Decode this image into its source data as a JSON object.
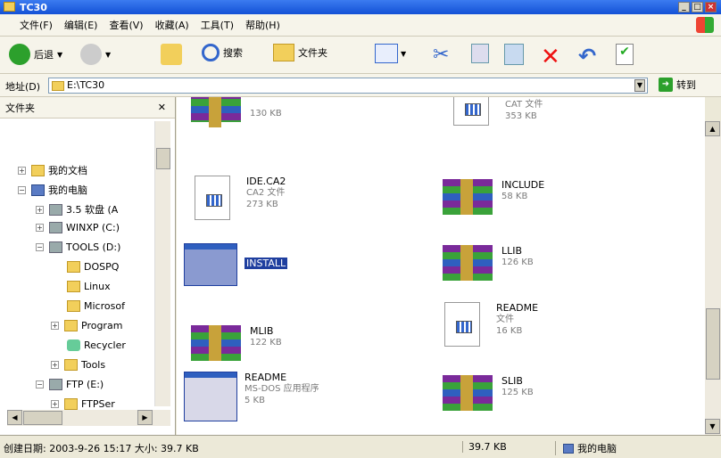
{
  "window": {
    "title": "TC30"
  },
  "menu": [
    "文件(F)",
    "编辑(E)",
    "查看(V)",
    "收藏(A)",
    "工具(T)",
    "帮助(H)"
  ],
  "toolbar": {
    "back": "后退",
    "search": "搜索",
    "folders": "文件夹"
  },
  "address": {
    "label": "地址(D)",
    "path": "E:\\TC30",
    "go": "转到"
  },
  "tree": {
    "header": "文件夹",
    "nodes": [
      "我的文档",
      "我的电脑",
      "3.5 软盘 (A",
      "WINXP (C:)",
      "TOOLS (D:)",
      "DOSPQ",
      "Linux",
      "Microsof",
      "Program",
      "Recycler",
      "Tools",
      "FTP (E:)",
      "FTPSer"
    ]
  },
  "files": [
    {
      "name": "",
      "sub": "130 KB"
    },
    {
      "name": "CAT 文件",
      "sub": "353 KB"
    },
    {
      "name": "IDE.CA2",
      "sub": "CA2 文件",
      "sub2": "273 KB"
    },
    {
      "name": "INCLUDE",
      "sub": "58 KB"
    },
    {
      "name": "INSTALL",
      "sub": ""
    },
    {
      "name": "LLIB",
      "sub": "126 KB"
    },
    {
      "name": "MLIB",
      "sub": "122 KB"
    },
    {
      "name": "README",
      "sub": "文件",
      "sub2": "16 KB"
    },
    {
      "name": "README",
      "sub": "MS-DOS 应用程序",
      "sub2": "5 KB"
    },
    {
      "name": "SLIB",
      "sub": "125 KB"
    }
  ],
  "status": {
    "info": "创建日期: 2003-9-26 15:17 大小: 39.7 KB",
    "size": "39.7 KB",
    "location": "我的电脑"
  }
}
